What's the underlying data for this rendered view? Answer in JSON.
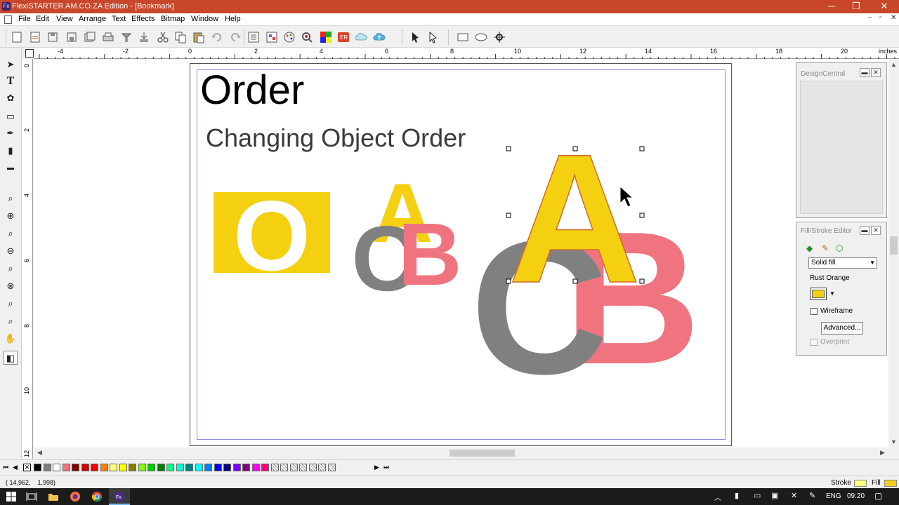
{
  "window": {
    "title": "FlexiSTARTER AM.CO.ZA Edition - [Bookmark]",
    "app_icon": "Fx",
    "controls": {
      "minimize": "─",
      "maximize": "❐",
      "close": "✕"
    }
  },
  "menu": {
    "items": [
      "File",
      "Edit",
      "View",
      "Arrange",
      "Text",
      "Effects",
      "Bitmap",
      "Window",
      "Help"
    ],
    "mdi_controls": [
      "–",
      "▫",
      "✕"
    ]
  },
  "toolbar": {
    "icons": [
      "new-icon",
      "open-icon",
      "save-icon",
      "save-as-icon",
      "save-all-icon",
      "print-icon",
      "send-icon",
      "output-icon",
      "cut-icon",
      "copy-icon",
      "paste-icon",
      "undo-icon",
      "redo-icon",
      "properties-icon",
      "layers-icon",
      "color-icon",
      "find-icon",
      "palette-icon",
      "er-icon",
      "cloud-icon",
      "cloud-upload-icon",
      "select-icon",
      "node-select-icon",
      "rectangle-icon",
      "ellipse-icon",
      "snap-icon"
    ]
  },
  "ruler": {
    "unit": "inches",
    "h_labels": [
      "-4",
      "-2",
      "0",
      "2",
      "4",
      "6",
      "8",
      "10",
      "12",
      "14",
      "16",
      "18",
      "20"
    ],
    "v_labels": [
      "0",
      "2",
      "4",
      "6",
      "8",
      "10",
      "12"
    ]
  },
  "tools": [
    "select-tool",
    "text-tool",
    "shape-tool",
    "rectangle-tool",
    "pen-tool",
    "fill-tool",
    "ruler-tool",
    "zoom-area-tool",
    "zoom-in-tool",
    "zoom-page-tool",
    "zoom-out-tool",
    "zoom-fit-tool",
    "zoom-selection-tool",
    "zoom-previous-tool",
    "zoom-all-tool",
    "pan-tool",
    "color-tool"
  ],
  "document": {
    "heading": "Order",
    "subheading": "Changing Object Order",
    "letters": {
      "o": "O",
      "a": "A",
      "b": "B",
      "c": "C"
    },
    "colors": {
      "yellow": "#f4d010",
      "pink": "#f07480",
      "gray": "#808080",
      "white": "#ffffff"
    }
  },
  "design_central": {
    "title": "DesignCentral"
  },
  "fill_stroke": {
    "title": "Fill/Stroke Editor",
    "fill_type": "Solid fill",
    "color_name": "Rust Orange",
    "color_hex": "#f4d010",
    "wireframe_label": "Wireframe",
    "advanced_label": "Advanced...",
    "overprint_label": "Overprint"
  },
  "palette": {
    "colors": [
      "#000000",
      "#808080",
      "#ffffff",
      "#f07480",
      "#800000",
      "#cc0000",
      "#ff0000",
      "#ff8000",
      "#ffff80",
      "#ffff00",
      "#808000",
      "#80ff00",
      "#00cc00",
      "#008000",
      "#00ff80",
      "#00ffcc",
      "#008080",
      "#00ffff",
      "#0080ff",
      "#0000ff",
      "#000080",
      "#8000ff",
      "#800080",
      "#ff00ff",
      "#ff0080"
    ]
  },
  "status": {
    "coords": "( 14,962,    1,998)",
    "stroke_label": "Stroke",
    "fill_label": "Fill",
    "stroke_color": "#ffff80",
    "fill_color": "#f4d010"
  },
  "taskbar": {
    "language": "ENG",
    "time": "09:20"
  }
}
